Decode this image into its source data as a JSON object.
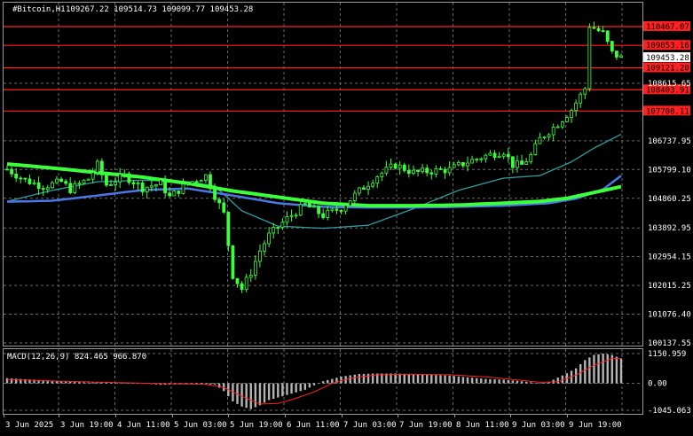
{
  "header": {
    "symbol": "#Bitcoin,H1",
    "ohlc": "109267.22 109514.73 109099.77 109453.28"
  },
  "colors": {
    "background": "#000000",
    "grid": "#6a6a6a",
    "bull_candle": "#3cff3c",
    "bear_candle": "#3cff3c",
    "ma_fast": "#2f9ea0",
    "ma_mid": "#4b78e6",
    "ma_slow": "#3cff3c",
    "level_line": "#ff2020",
    "level_label_bg": "#ff2020",
    "price_label_bg": "#ffffff",
    "macd_hist": "#b4b4b4",
    "macd_signal": "#ff2020",
    "axis_text": "#ffffff"
  },
  "price_axis": {
    "ticks": [
      "106737.95",
      "105799.10",
      "104860.25",
      "103892.95",
      "102954.15",
      "102015.25",
      "101076.40",
      "100137.55"
    ],
    "partial_tick": "108615.65"
  },
  "levels": [
    {
      "label": "110467.07",
      "value": 110467.07
    },
    {
      "label": "109853.16",
      "value": 109853.16
    },
    {
      "label": "109121.20",
      "value": 109121.2
    },
    {
      "label": "108403.91",
      "value": 108403.91
    },
    {
      "label": "107708.11",
      "value": 107708.11
    }
  ],
  "current_price": {
    "label": "109453.28",
    "value": 109453.28
  },
  "time_axis": [
    "3 Jun 2025",
    "3 Jun 19:00",
    "4 Jun 11:00",
    "5 Jun 03:00",
    "5 Jun 19:00",
    "6 Jun 11:00",
    "7 Jun 03:00",
    "7 Jun 19:00",
    "8 Jun 11:00",
    "9 Jun 03:00",
    "9 Jun 19:00"
  ],
  "macd": {
    "title": "MACD(12,26,9) 824.465 966.870",
    "ticks": [
      "1150.959",
      "0.00",
      "-1045.063"
    ]
  },
  "chart_data": {
    "type": "candlestick",
    "title": "#Bitcoin,H1",
    "ylim": [
      100137.55,
      110900
    ],
    "close_path": [
      [
        0,
        105810
      ],
      [
        4,
        105450
      ],
      [
        8,
        105250
      ],
      [
        12,
        105400
      ],
      [
        14,
        105150
      ],
      [
        18,
        105500
      ],
      [
        20,
        105950
      ],
      [
        22,
        105300
      ],
      [
        26,
        105600
      ],
      [
        30,
        105200
      ],
      [
        34,
        105350
      ],
      [
        36,
        104900
      ],
      [
        40,
        105350
      ],
      [
        44,
        105600
      ],
      [
        46,
        104950
      ],
      [
        48,
        104350
      ],
      [
        50,
        102350
      ],
      [
        52,
        101900
      ],
      [
        54,
        102450
      ],
      [
        56,
        103150
      ],
      [
        58,
        103650
      ],
      [
        62,
        104200
      ],
      [
        66,
        104650
      ],
      [
        70,
        104300
      ],
      [
        74,
        104550
      ],
      [
        78,
        105100
      ],
      [
        82,
        105600
      ],
      [
        86,
        105950
      ],
      [
        90,
        105700
      ],
      [
        94,
        105750
      ],
      [
        98,
        105800
      ],
      [
        102,
        106050
      ],
      [
        106,
        106250
      ],
      [
        110,
        106400
      ],
      [
        112,
        105950
      ],
      [
        114,
        105950
      ],
      [
        116,
        106250
      ],
      [
        118,
        106800
      ],
      [
        122,
        107300
      ],
      [
        125,
        107750
      ],
      [
        128,
        108450
      ],
      [
        129,
        110500
      ],
      [
        132,
        110250
      ],
      [
        134,
        109600
      ],
      [
        136,
        109453.28
      ]
    ],
    "series": [
      {
        "name": "MA fast",
        "points": [
          [
            0,
            104760
          ],
          [
            10,
            105120
          ],
          [
            20,
            105400
          ],
          [
            30,
            105450
          ],
          [
            40,
            105400
          ],
          [
            46,
            105260
          ],
          [
            52,
            104450
          ],
          [
            60,
            103950
          ],
          [
            70,
            103880
          ],
          [
            80,
            103980
          ],
          [
            90,
            104520
          ],
          [
            100,
            105120
          ],
          [
            110,
            105520
          ],
          [
            118,
            105600
          ],
          [
            125,
            106050
          ],
          [
            130,
            106500
          ],
          [
            136,
            106950
          ]
        ]
      },
      {
        "name": "MA mid",
        "points": [
          [
            0,
            104750
          ],
          [
            10,
            104780
          ],
          [
            20,
            104950
          ],
          [
            30,
            105130
          ],
          [
            40,
            105180
          ],
          [
            50,
            104950
          ],
          [
            60,
            104700
          ],
          [
            70,
            104580
          ],
          [
            80,
            104560
          ],
          [
            90,
            104560
          ],
          [
            100,
            104580
          ],
          [
            110,
            104620
          ],
          [
            120,
            104700
          ],
          [
            126,
            104850
          ],
          [
            132,
            105150
          ],
          [
            136,
            105600
          ]
        ]
      },
      {
        "name": "MA slow",
        "points": [
          [
            0,
            105980
          ],
          [
            10,
            105850
          ],
          [
            20,
            105700
          ],
          [
            30,
            105550
          ],
          [
            40,
            105350
          ],
          [
            50,
            105100
          ],
          [
            60,
            104900
          ],
          [
            70,
            104700
          ],
          [
            80,
            104620
          ],
          [
            90,
            104620
          ],
          [
            100,
            104640
          ],
          [
            110,
            104700
          ],
          [
            118,
            104760
          ],
          [
            124,
            104860
          ],
          [
            130,
            105050
          ],
          [
            136,
            105240
          ]
        ]
      }
    ],
    "macd_hist": [
      [
        0,
        200
      ],
      [
        6,
        140
      ],
      [
        12,
        90
      ],
      [
        18,
        30
      ],
      [
        22,
        40
      ],
      [
        26,
        10
      ],
      [
        30,
        0
      ],
      [
        34,
        -60
      ],
      [
        38,
        -40
      ],
      [
        42,
        -30
      ],
      [
        46,
        -50
      ],
      [
        48,
        -300
      ],
      [
        50,
        -700
      ],
      [
        52,
        -900
      ],
      [
        54,
        -1000
      ],
      [
        56,
        -850
      ],
      [
        58,
        -650
      ],
      [
        62,
        -450
      ],
      [
        66,
        -250
      ],
      [
        68,
        -80
      ],
      [
        70,
        80
      ],
      [
        74,
        260
      ],
      [
        78,
        360
      ],
      [
        82,
        380
      ],
      [
        86,
        380
      ],
      [
        90,
        360
      ],
      [
        94,
        330
      ],
      [
        98,
        300
      ],
      [
        102,
        230
      ],
      [
        106,
        170
      ],
      [
        110,
        140
      ],
      [
        114,
        80
      ],
      [
        116,
        40
      ],
      [
        118,
        -10
      ],
      [
        120,
        60
      ],
      [
        122,
        220
      ],
      [
        124,
        390
      ],
      [
        126,
        580
      ],
      [
        128,
        900
      ],
      [
        130,
        1100
      ],
      [
        132,
        1150.959
      ],
      [
        134,
        1100
      ],
      [
        136,
        960
      ]
    ],
    "macd_signal": [
      [
        0,
        150
      ],
      [
        12,
        80
      ],
      [
        24,
        30
      ],
      [
        34,
        -10
      ],
      [
        44,
        -40
      ],
      [
        48,
        -160
      ],
      [
        52,
        -500
      ],
      [
        56,
        -800
      ],
      [
        60,
        -780
      ],
      [
        64,
        -580
      ],
      [
        68,
        -330
      ],
      [
        72,
        0
      ],
      [
        76,
        200
      ],
      [
        82,
        330
      ],
      [
        90,
        350
      ],
      [
        98,
        330
      ],
      [
        106,
        250
      ],
      [
        114,
        110
      ],
      [
        118,
        40
      ],
      [
        122,
        60
      ],
      [
        126,
        320
      ],
      [
        130,
        700
      ],
      [
        134,
        960
      ],
      [
        136,
        966.87
      ]
    ]
  }
}
